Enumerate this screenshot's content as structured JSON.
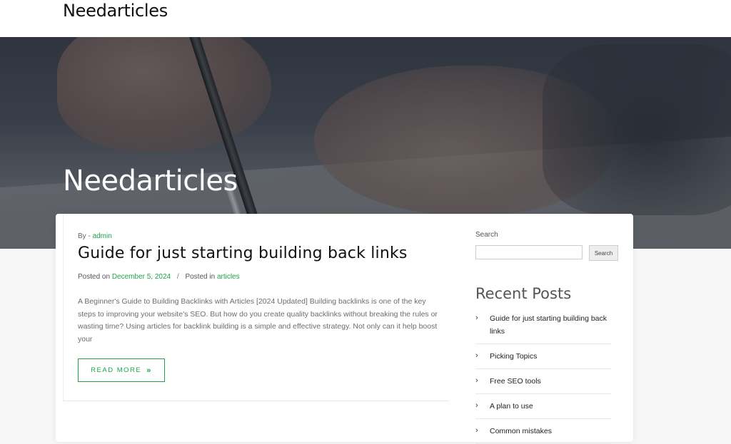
{
  "header": {
    "site_title": "Needarticles"
  },
  "hero": {
    "title": "Needarticles"
  },
  "post": {
    "by_prefix": "By -",
    "author": "admin",
    "title": "Guide for just starting building back links",
    "posted_on_label": "Posted on",
    "date": "December 5, 2024",
    "separator": "/",
    "posted_in_label": "Posted in",
    "category": "articles",
    "excerpt": "A Beginner's Guide to Building Backlinks with Articles [2024 Updated] Building backlinks is one of the key steps to improving your website's SEO. But how do you create quality backlinks without breaking the rules or wasting time? Using articles for backlink building is a simple and effective strategy. Not only can it help boost your",
    "read_more": "READ MORE",
    "read_more_icon": "»"
  },
  "sidebar": {
    "search_label": "Search",
    "search_value": "",
    "search_button": "Search",
    "recent_title": "Recent Posts",
    "recent_items": [
      {
        "label": "Guide for just starting building back links"
      },
      {
        "label": "Picking Topics"
      },
      {
        "label": "Free SEO tools"
      },
      {
        "label": "A plan to use"
      },
      {
        "label": "Common mistakes"
      }
    ],
    "chevron_icon": "›"
  },
  "colors": {
    "accent": "#1fa34a"
  }
}
